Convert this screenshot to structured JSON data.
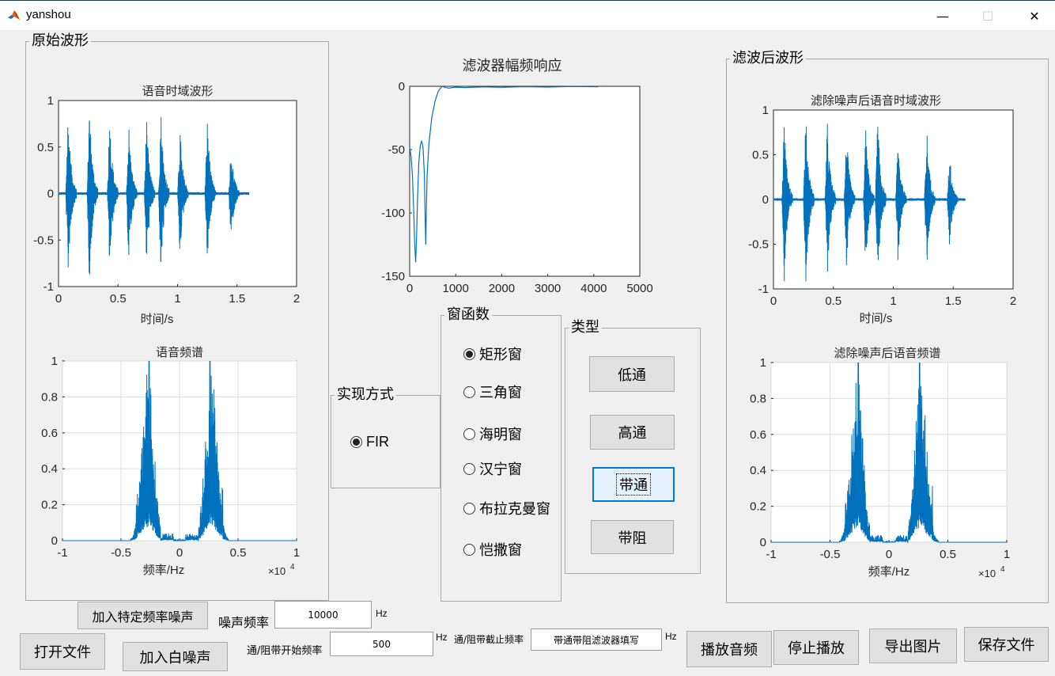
{
  "window": {
    "title": "yanshou",
    "minimize": "—",
    "maximize": "☐",
    "close": "✕"
  },
  "panels": {
    "original": "原始波形",
    "filtered": "滤波后波形",
    "method": "实现方式",
    "window_fn": "窗函数",
    "type": "类型"
  },
  "plots": {
    "orig_time": {
      "title": "语音时域波形",
      "xlabel": "时间/s",
      "xticks": [
        "0",
        "0.5",
        "1",
        "1.5",
        "2"
      ],
      "yticks": [
        "1",
        "0.5",
        "0",
        "-0.5",
        "-1"
      ]
    },
    "orig_spec": {
      "title": "语音频谱",
      "xlabel": "频率/Hz",
      "xticks": [
        "-1",
        "-0.5",
        "0",
        "0.5",
        "1"
      ],
      "yticks": [
        "1",
        "0.8",
        "0.6",
        "0.4",
        "0.2",
        "0"
      ],
      "exponent_base": "×10",
      "exponent_power": "4"
    },
    "filter_resp": {
      "title": "滤波器幅频响应",
      "xticks": [
        "0",
        "1000",
        "2000",
        "3000",
        "4000",
        "5000"
      ],
      "yticks": [
        "0",
        "-50",
        "-100",
        "-150"
      ]
    },
    "filt_time": {
      "title": "滤除噪声后语音时域波形",
      "xlabel": "时间/s",
      "xticks": [
        "0",
        "0.5",
        "1",
        "1.5",
        "2"
      ],
      "yticks": [
        "1",
        "0.5",
        "0",
        "-0.5",
        "-1"
      ]
    },
    "filt_spec": {
      "title": "滤除噪声后语音频谱",
      "xlabel": "频率/Hz",
      "xticks": [
        "-1",
        "-0.5",
        "0",
        "0.5",
        "1"
      ],
      "yticks": [
        "1",
        "0.8",
        "0.6",
        "0.4",
        "0.2",
        "0"
      ],
      "exponent_base": "×10",
      "exponent_power": "4"
    }
  },
  "chart_data": [
    {
      "type": "line",
      "title": "语音时域波形",
      "xlabel": "时间/s",
      "xlim": [
        0,
        2
      ],
      "ylim": [
        -1,
        1
      ],
      "bursts": [
        {
          "t": 0.08,
          "amp": 0.92
        },
        {
          "t": 0.26,
          "amp": 1.0
        },
        {
          "t": 0.43,
          "amp": 0.87
        },
        {
          "t": 0.59,
          "amp": 0.79
        },
        {
          "t": 0.74,
          "amp": 0.82
        },
        {
          "t": 0.86,
          "amp": 0.94
        },
        {
          "t": 1.02,
          "amp": 0.72
        },
        {
          "t": 1.25,
          "amp": 0.82
        },
        {
          "t": 1.45,
          "amp": 0.54
        }
      ],
      "signal_end": 1.6,
      "color": "#0072bd"
    },
    {
      "type": "line",
      "title": "语音频谱",
      "xlabel": "频率/Hz",
      "xlim": [
        -10000,
        10000
      ],
      "ylim": [
        0,
        1
      ],
      "band_peaks": [
        -2600,
        2600
      ],
      "peak_value": 1.0,
      "color": "#0072bd"
    },
    {
      "type": "line",
      "title": "滤波器幅频响应",
      "xlim": [
        0,
        5000
      ],
      "ylim": [
        -150,
        0
      ],
      "points": [
        [
          0,
          -48
        ],
        [
          30,
          -55
        ],
        [
          60,
          -70
        ],
        [
          90,
          -100
        ],
        [
          110,
          -125
        ],
        [
          130,
          -139
        ],
        [
          150,
          -120
        ],
        [
          170,
          -90
        ],
        [
          200,
          -60
        ],
        [
          230,
          -47
        ],
        [
          260,
          -43
        ],
        [
          290,
          -48
        ],
        [
          320,
          -70
        ],
        [
          340,
          -110
        ],
        [
          350,
          -125
        ],
        [
          360,
          -100
        ],
        [
          380,
          -70
        ],
        [
          420,
          -45
        ],
        [
          480,
          -25
        ],
        [
          550,
          -12
        ],
        [
          620,
          -4
        ],
        [
          700,
          0
        ],
        [
          780,
          -1
        ],
        [
          850,
          -1.5
        ],
        [
          1000,
          -0.7
        ],
        [
          1200,
          -1
        ],
        [
          1600,
          -0.5
        ],
        [
          2000,
          -0.8
        ],
        [
          2500,
          -0.3
        ],
        [
          3000,
          -0.6
        ],
        [
          3500,
          -0.2
        ],
        [
          4096,
          -0.4
        ]
      ],
      "color": "#0072bd"
    },
    {
      "type": "line",
      "title": "滤除噪声后语音时域波形",
      "xlabel": "时间/s",
      "xlim": [
        0,
        2
      ],
      "ylim": [
        -1,
        1
      ],
      "bursts": [
        {
          "t": 0.09,
          "amp": 0.95
        },
        {
          "t": 0.27,
          "amp": 0.98
        },
        {
          "t": 0.45,
          "amp": 0.88
        },
        {
          "t": 0.61,
          "amp": 0.78
        },
        {
          "t": 0.77,
          "amp": 0.8
        },
        {
          "t": 0.87,
          "amp": 0.95
        },
        {
          "t": 1.04,
          "amp": 0.73
        },
        {
          "t": 1.28,
          "amp": 0.82
        },
        {
          "t": 1.47,
          "amp": 0.56
        }
      ],
      "signal_end": 1.6,
      "color": "#0072bd"
    },
    {
      "type": "line",
      "title": "滤除噪声后语音频谱",
      "xlabel": "频率/Hz",
      "xlim": [
        -10000,
        10000
      ],
      "ylim": [
        0,
        1
      ],
      "band_peaks": [
        -2600,
        2600
      ],
      "peak_value": 1.0,
      "color": "#0072bd"
    }
  ],
  "method": {
    "fir_label": "FIR",
    "fir_selected": true
  },
  "window_options": [
    {
      "label": "矩形窗",
      "selected": true
    },
    {
      "label": "三角窗",
      "selected": false
    },
    {
      "label": "海明窗",
      "selected": false
    },
    {
      "label": "汉宁窗",
      "selected": false
    },
    {
      "label": "布拉克曼窗",
      "selected": false
    },
    {
      "label": "恺撒窗",
      "selected": false
    }
  ],
  "filter_types": {
    "lowpass": "低通",
    "highpass": "高通",
    "bandpass": "带通",
    "bandstop": "带阻"
  },
  "controls": {
    "add_specific_noise": "加入特定频率噪声",
    "noise_freq_label": "噪声频率",
    "noise_freq_value": "10000",
    "hz": "Hz",
    "open_file": "打开文件",
    "add_white_noise": "加入白噪声",
    "pass_start_label": "通/阻带开始频率",
    "pass_start_value": "500",
    "pass_end_label": "通/阻带截止频率",
    "pass_end_value": "带通带阻滤波器填写",
    "play": "播放音频",
    "stop": "停止播放",
    "export_image": "导出图片",
    "save_file": "保存文件"
  }
}
